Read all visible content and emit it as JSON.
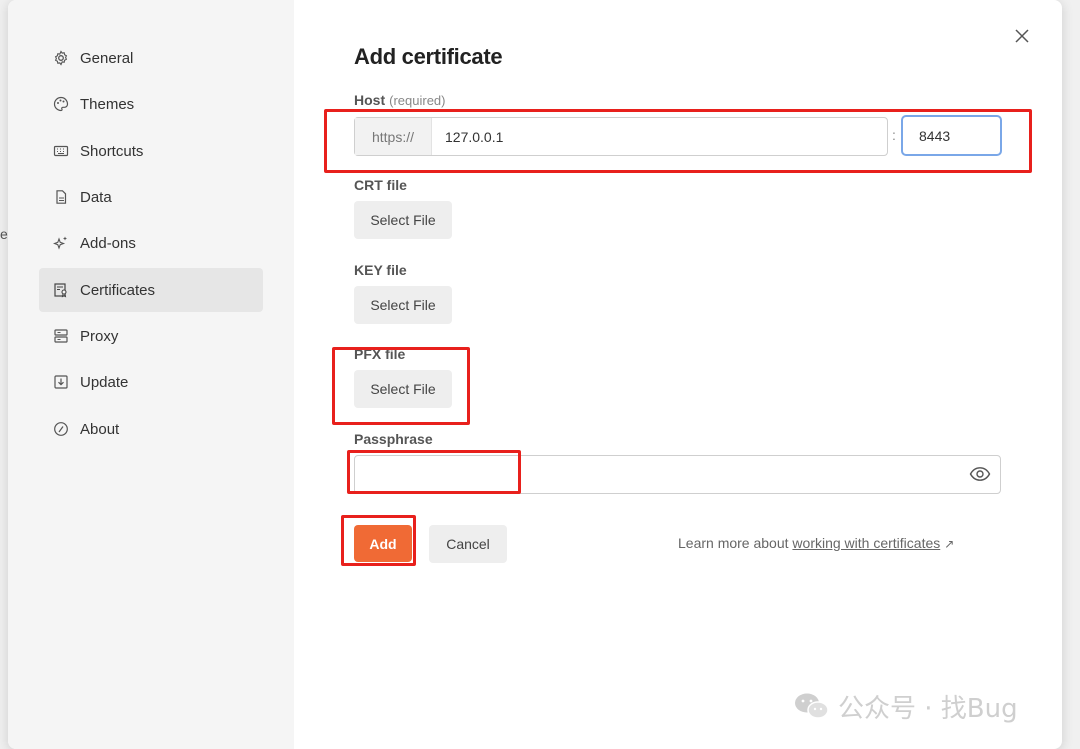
{
  "sidebar": {
    "items": [
      {
        "label": "General",
        "icon": "gear-icon"
      },
      {
        "label": "Themes",
        "icon": "palette-icon"
      },
      {
        "label": "Shortcuts",
        "icon": "keyboard-icon"
      },
      {
        "label": "Data",
        "icon": "database-icon"
      },
      {
        "label": "Add-ons",
        "icon": "sparkles-icon"
      },
      {
        "label": "Certificates",
        "icon": "certificate-icon",
        "active": true
      },
      {
        "label": "Proxy",
        "icon": "server-icon"
      },
      {
        "label": "Update",
        "icon": "download-icon"
      },
      {
        "label": "About",
        "icon": "info-icon"
      }
    ]
  },
  "stray_text": "e",
  "dialog": {
    "title": "Add certificate",
    "host": {
      "label": "Host",
      "hint": "(required)",
      "prefix": "https://",
      "value": "127.0.0.1",
      "separator": ":",
      "port": "8443"
    },
    "crt": {
      "label": "CRT file",
      "button": "Select File"
    },
    "key": {
      "label": "KEY file",
      "button": "Select File"
    },
    "pfx": {
      "label": "PFX file",
      "button": "Select File"
    },
    "passphrase": {
      "label": "Passphrase",
      "value": ""
    },
    "add_button": "Add",
    "cancel_button": "Cancel",
    "learn_more": {
      "text": "Learn more about",
      "link": "working with certificates",
      "arrow": "↗"
    }
  },
  "watermark": {
    "text": "公众号 · 找Bug"
  },
  "colors": {
    "accent": "#f06a35",
    "highlight": "#e8201c",
    "focus": "#7aa7e8"
  }
}
